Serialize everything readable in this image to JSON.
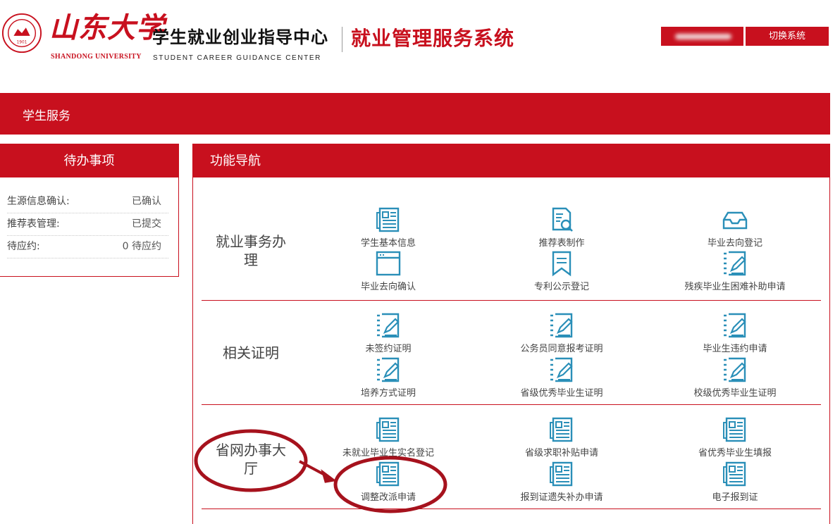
{
  "header": {
    "university_cn": "山东大学",
    "university_en": "SHANDONG UNIVERSITY",
    "seal_year": "1901",
    "center_cn": "学生就业创业指导中心",
    "center_en": "STUDENT CAREER GUIDANCE CENTER",
    "system_title": "就业管理服务系统",
    "switch_label": "切换系统"
  },
  "menu": {
    "label": "学生服务"
  },
  "todo": {
    "title": "待办事项",
    "rows": [
      {
        "label": "生源信息确认:",
        "value": "已确认"
      },
      {
        "label": "推荐表管理:",
        "value": "已提交"
      },
      {
        "label": "待应约:",
        "value": "0 待应约"
      }
    ]
  },
  "nav": {
    "title": "功能导航",
    "sections": [
      {
        "title_lines": [
          "就业事务办",
          "理"
        ],
        "items": [
          {
            "label": "学生基本信息",
            "icon": "news-icon"
          },
          {
            "label": "推荐表制作",
            "icon": "document-search-icon"
          },
          {
            "label": "毕业去向登记",
            "icon": "inbox-icon"
          },
          {
            "label": "毕业去向确认",
            "icon": "window-icon"
          },
          {
            "label": "专利公示登记",
            "icon": "bookmark-icon"
          },
          {
            "label": "残疾毕业生困难补助申请",
            "icon": "edit-icon"
          }
        ]
      },
      {
        "title_lines": [
          "相关证明"
        ],
        "items": [
          {
            "label": "未签约证明",
            "icon": "edit-icon"
          },
          {
            "label": "公务员同意报考证明",
            "icon": "edit-icon"
          },
          {
            "label": "毕业生违约申请",
            "icon": "edit-icon"
          },
          {
            "label": "培养方式证明",
            "icon": "edit-icon"
          },
          {
            "label": "省级优秀毕业生证明",
            "icon": "edit-icon"
          },
          {
            "label": "校级优秀毕业生证明",
            "icon": "edit-icon"
          }
        ]
      },
      {
        "title_lines": [
          "省网办事大",
          "厅"
        ],
        "items": [
          {
            "label": "未就业毕业生实名登记",
            "icon": "news-icon"
          },
          {
            "label": "省级求职补贴申请",
            "icon": "news-icon"
          },
          {
            "label": "省优秀毕业生填报",
            "icon": "news-icon"
          },
          {
            "label": "调整改派申请",
            "icon": "news-icon"
          },
          {
            "label": "报到证遗失补办申请",
            "icon": "news-icon"
          },
          {
            "label": "电子报到证",
            "icon": "news-icon"
          }
        ]
      }
    ]
  },
  "colors": {
    "brand_red": "#c8101e",
    "icon_teal": "#2a8fb8",
    "annotation_red": "#a6121d"
  }
}
